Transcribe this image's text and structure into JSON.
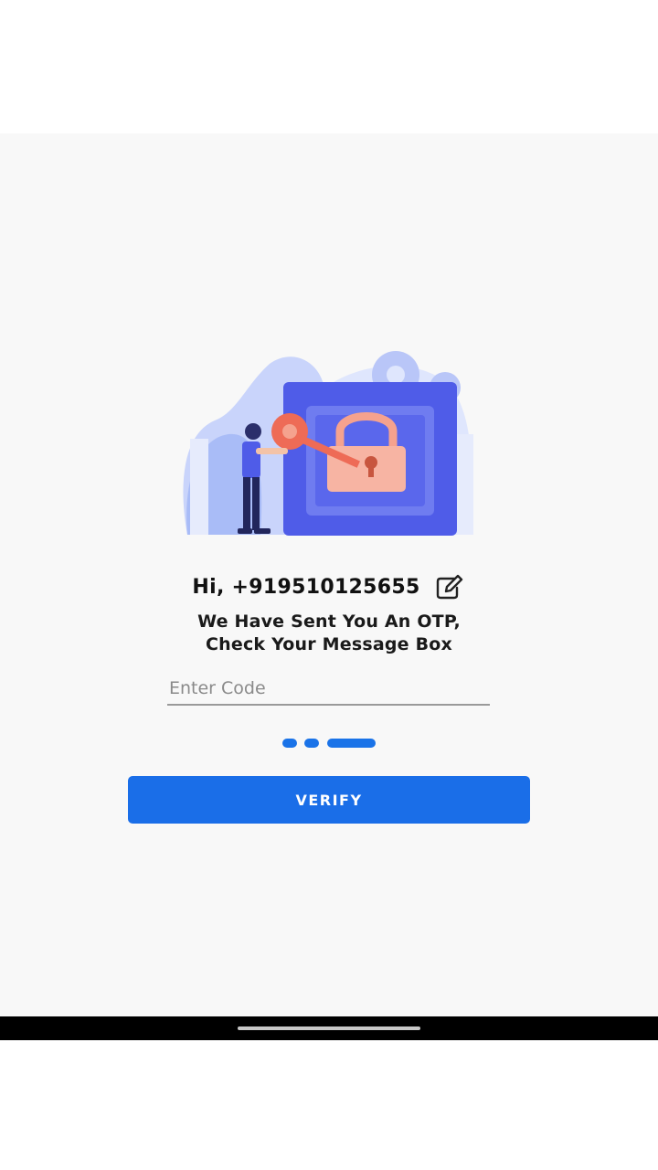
{
  "greeting": {
    "text": "Hi, +919510125655",
    "edit_icon": "edit-icon"
  },
  "message": {
    "line1": "We Have Sent You An OTP,",
    "line2": "Check Your Message Box"
  },
  "otp_input": {
    "value": "",
    "placeholder": "Enter Code"
  },
  "pager": {
    "steps": 3,
    "current_step": 3
  },
  "verify_button": {
    "label": "VERIFY"
  },
  "colors": {
    "accent": "#1a6ee8",
    "background": "#f8f8f8",
    "illustration_blue": "#4f5ce8",
    "illustration_lock": "#f5a28e"
  }
}
